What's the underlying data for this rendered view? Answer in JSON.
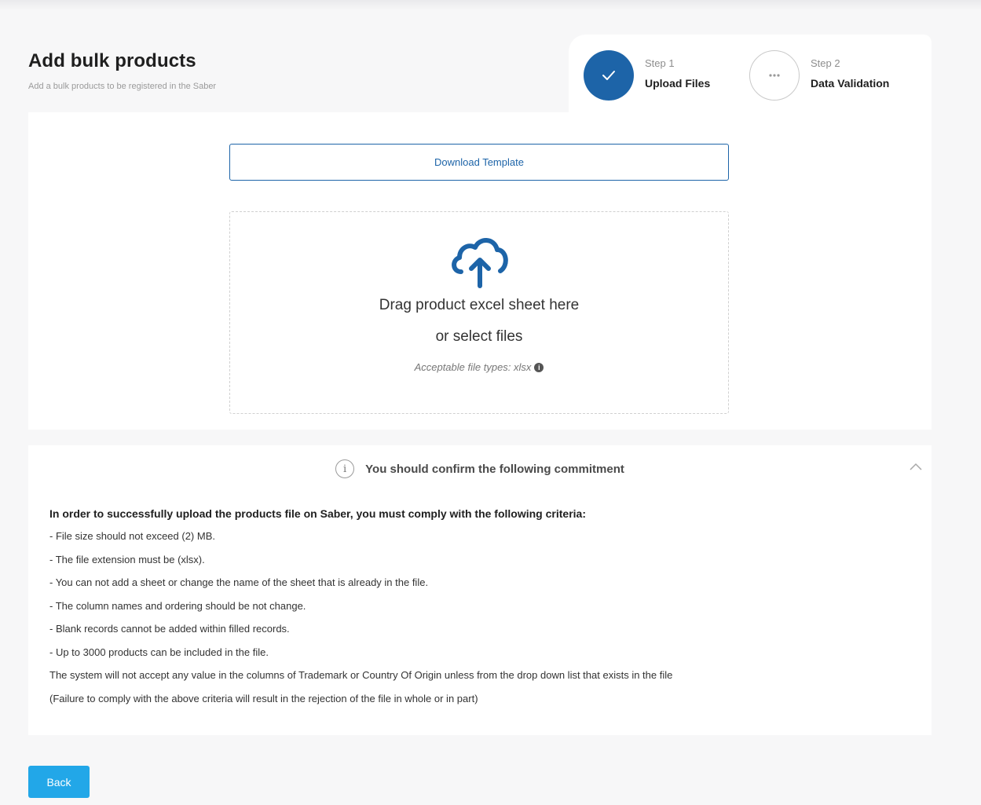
{
  "header": {
    "title": "Add bulk products",
    "subtitle": "Add a bulk products to be registered in the Saber"
  },
  "stepper": {
    "steps": [
      {
        "number_label": "Step 1",
        "label": "Upload Files",
        "status": "completed",
        "icon": "checkmark-icon"
      },
      {
        "number_label": "Step 2",
        "label": "Data Validation",
        "status": "pending",
        "icon": "ellipsis-icon"
      }
    ]
  },
  "upload": {
    "download_label": "Download Template",
    "drop_text": "Drag product excel sheet here",
    "select_text": "or select files",
    "file_types_hint": "Acceptable file types: xlsx",
    "icon": "cloud-upload-icon"
  },
  "commitment": {
    "title": "You should confirm the following commitment",
    "heading": "In order to successfully upload the products file on Saber, you must comply with the following criteria:",
    "items": [
      "- File size should not exceed (2) MB.",
      "- The file extension must be (xlsx).",
      "- You can not add a sheet or change the name of the sheet that is already in the file.",
      "- The column names and ordering should be not change.",
      "- Blank records cannot be added within filled records.",
      "- Up to 3000 products can be included in the file.",
      "The system will not accept any value in the columns of Trademark or Country Of Origin unless from the drop down list that exists in the file",
      "(Failure to comply with the above criteria will result in the rejection of the file in whole or in part)"
    ]
  },
  "actions": {
    "back_label": "Back"
  },
  "colors": {
    "primary": "#1d64a8",
    "back_button": "#22a7e8",
    "background": "#f7f7f8"
  }
}
